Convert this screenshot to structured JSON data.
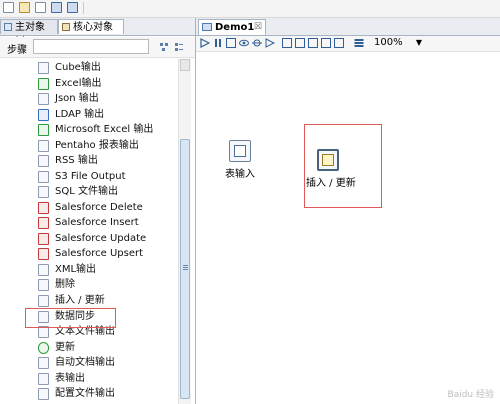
{
  "left_panel": {
    "tabs": [
      {
        "label": "主对象树"
      },
      {
        "label": "核心对象"
      }
    ],
    "steps_label": "步骤",
    "search": {
      "value": "",
      "placeholder": ""
    },
    "items": [
      {
        "label": "Cube输出",
        "icon": "doc-icon"
      },
      {
        "label": "Excel输出",
        "icon": "excel-icon"
      },
      {
        "label": "Json 输出",
        "icon": "doc-icon"
      },
      {
        "label": "LDAP 输出",
        "icon": "ldap-icon"
      },
      {
        "label": "Microsoft Excel 输出",
        "icon": "excel-icon"
      },
      {
        "label": "Pentaho 报表输出",
        "icon": "report-icon"
      },
      {
        "label": "RSS 输出",
        "icon": "rss-icon"
      },
      {
        "label": "S3 File Output",
        "icon": "doc-icon"
      },
      {
        "label": "SQL 文件输出",
        "icon": "sql-icon"
      },
      {
        "label": "Salesforce Delete",
        "icon": "salesforce-icon"
      },
      {
        "label": "Salesforce Insert",
        "icon": "salesforce-icon"
      },
      {
        "label": "Salesforce Update",
        "icon": "salesforce-icon"
      },
      {
        "label": "Salesforce Upsert",
        "icon": "salesforce-icon"
      },
      {
        "label": "XML输出",
        "icon": "xml-icon"
      },
      {
        "label": "删除",
        "icon": "delete-icon"
      },
      {
        "label": "插入 / 更新",
        "icon": "insert-update-icon"
      },
      {
        "label": "数据同步",
        "icon": "sync-icon"
      },
      {
        "label": "文本文件输出",
        "icon": "text-file-icon"
      },
      {
        "label": "更新",
        "icon": "update-icon"
      },
      {
        "label": "自动文档输出",
        "icon": "auto-doc-icon"
      },
      {
        "label": "表输出",
        "icon": "table-output-icon"
      },
      {
        "label": "配置文件输出",
        "icon": "config-file-icon"
      }
    ]
  },
  "editor": {
    "tab_label": "Demo1",
    "tab_close": "☒",
    "zoom": "100%",
    "canvas_nodes": [
      {
        "label": "表输入",
        "icon": "table-input-icon"
      },
      {
        "label": "插入 / 更新",
        "icon": "insert-update-icon"
      }
    ]
  },
  "watermark": "Baidu 经验"
}
